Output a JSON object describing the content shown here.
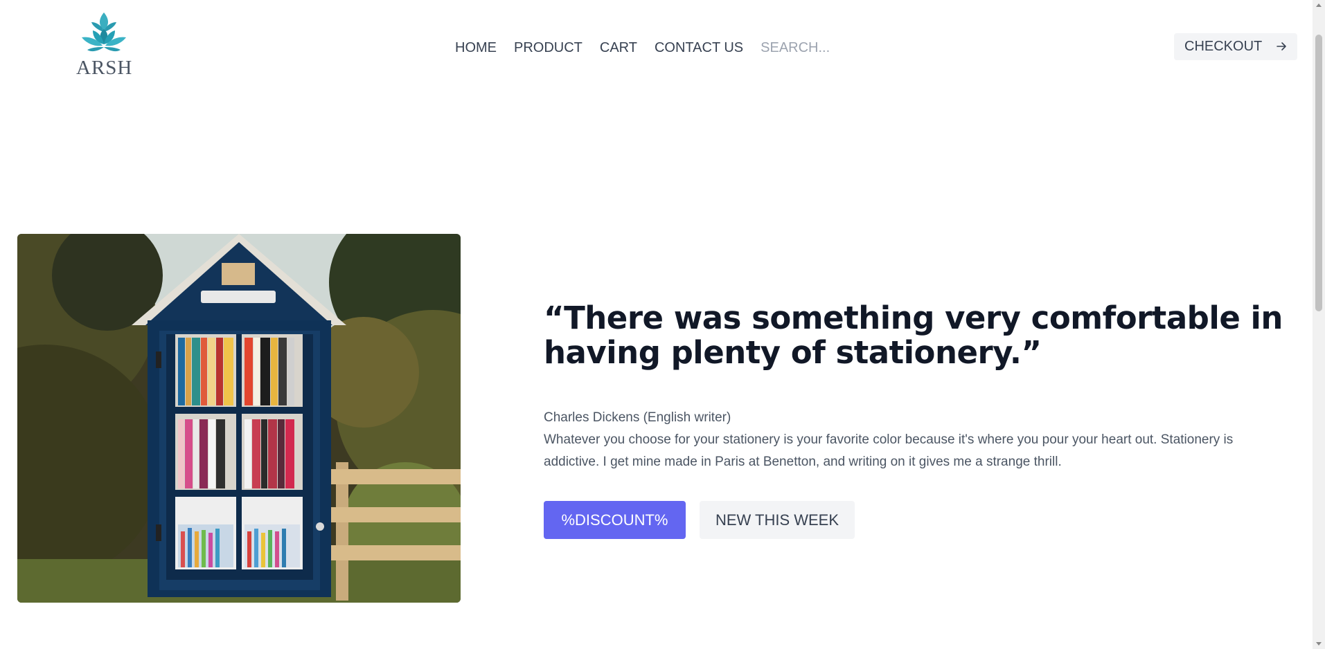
{
  "brand": {
    "name": "ARSH",
    "logo_icon": "lotus-icon",
    "logo_color": "#2a9bb0"
  },
  "nav": {
    "items": [
      {
        "label": "HOME"
      },
      {
        "label": "PRODUCT"
      },
      {
        "label": "CART"
      },
      {
        "label": "CONTACT US"
      }
    ],
    "search_placeholder": "SEARCH..."
  },
  "checkout": {
    "label": "CHECKOUT",
    "icon": "arrow-right-icon"
  },
  "hero": {
    "image_alt": "Little free library book cabinet",
    "quote": "“There was something very comfortable in having plenty of stationery.”",
    "author": "Charles Dickens (English writer)",
    "description": "Whatever you choose for your stationery is your favorite color because it's where you pour your heart out. Stationery is addictive. I get mine made in Paris at Benetton, and writing on it gives me a strange thrill.",
    "primary_button": "%DISCOUNT%",
    "secondary_button": "NEW THIS WEEK"
  },
  "colors": {
    "accent": "#6366f1",
    "button_secondary_bg": "#f3f4f6",
    "heading": "#111827",
    "body_text": "#4b5563"
  }
}
